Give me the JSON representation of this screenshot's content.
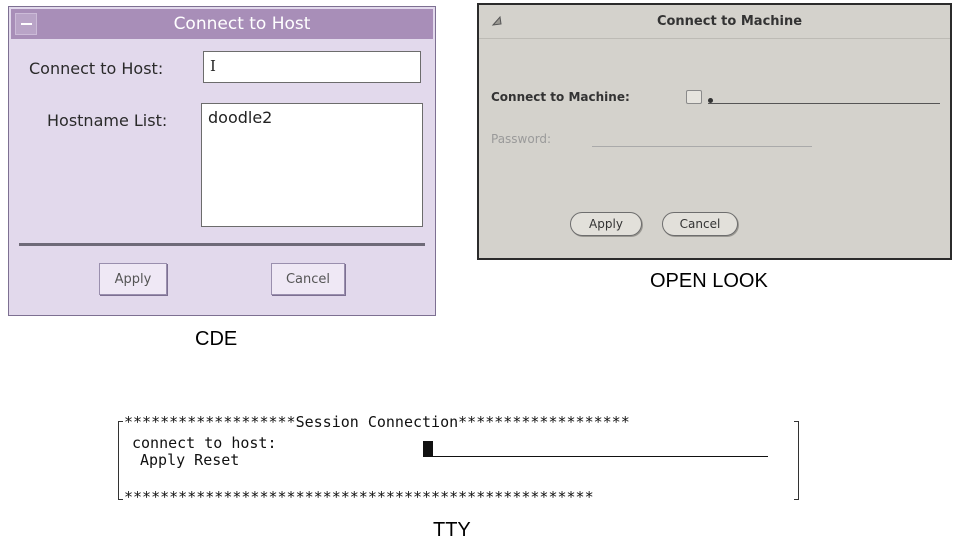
{
  "cde": {
    "title": "Connect to Host",
    "host_label": "Connect to Host:",
    "host_value": "I",
    "list_label": "Hostname List:",
    "hostnames": [
      "doodle2"
    ],
    "apply": "Apply",
    "cancel": "Cancel",
    "caption": "CDE"
  },
  "openlook": {
    "title": "Connect to Machine",
    "machine_label": "Connect to Machine:",
    "password_label": "Password:",
    "apply": "Apply",
    "cancel": "Cancel",
    "caption": "OPEN LOOK"
  },
  "tty": {
    "header": "*******************Session Connection*******************",
    "prompt": "connect to host:",
    "actions": "Apply Reset",
    "footer": "****************************************************",
    "caption": "TTY"
  },
  "colors": {
    "cde_bg": "#e2d9ec",
    "cde_title": "#a88eb8",
    "openlook_bg": "#d4d2cc"
  }
}
